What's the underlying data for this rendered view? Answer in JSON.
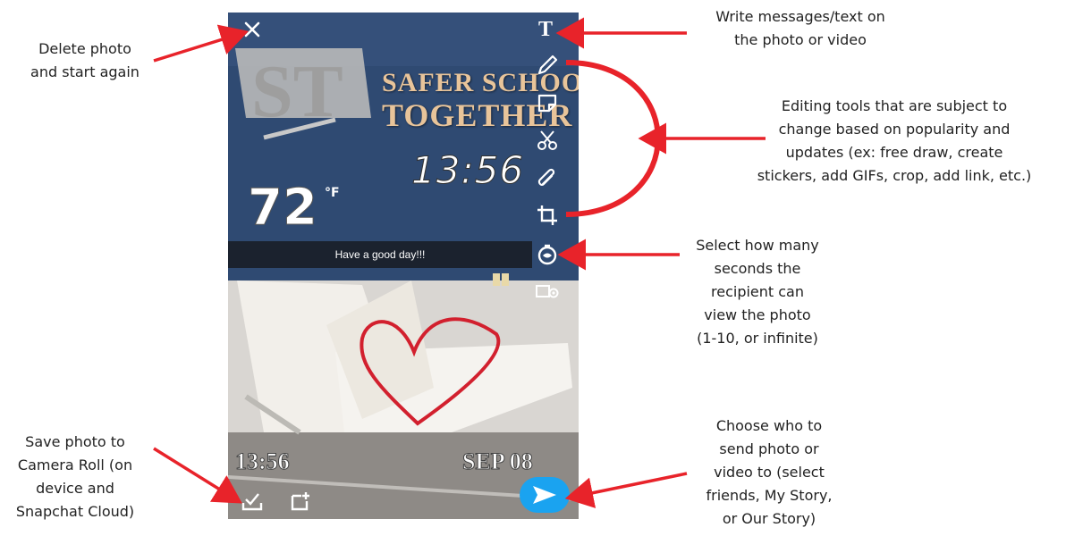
{
  "snap": {
    "brand_line1": "SAFER SCHOOLS",
    "brand_line2": "TOGETHER",
    "sticker_time": "13:56",
    "temperature": "72",
    "temperature_unit": "°F",
    "caption": "Have a good day!!!",
    "bottom_time": "13:56",
    "bottom_date": "SEP 08",
    "text_tool_glyph": "T"
  },
  "icons": {
    "close": "close-icon",
    "text": "text-tool-icon",
    "draw": "pencil-icon",
    "sticker": "sticker-icon",
    "scissors": "scissors-icon",
    "attach": "paperclip-icon",
    "crop": "crop-icon",
    "timer": "timer-icon",
    "viewers": "viewers-icon",
    "save": "save-download-icon",
    "add_story": "add-story-icon",
    "send": "send-arrow-icon"
  },
  "colors": {
    "wall": "#2f4a72",
    "send_button": "#1aa3f0",
    "annotation_arrow": "#e8232a",
    "brand_gold": "#e8c49a"
  },
  "annotations": {
    "delete": [
      "Delete photo",
      "and start again"
    ],
    "text": [
      "Write messages/text on",
      "the photo or video"
    ],
    "editing": [
      "Editing tools that are subject to",
      "change based on popularity and",
      "updates (ex: free draw, create",
      "stickers, add GIFs, crop, add link, etc.)"
    ],
    "timer": [
      "Select how many",
      "seconds the",
      "recipient can",
      "view the photo",
      "(1-10, or infinite)"
    ],
    "save": [
      "Save photo to",
      "Camera Roll (on",
      "device and",
      "Snapchat Cloud)"
    ],
    "send": [
      "Choose who to",
      "send photo or",
      "video to (select",
      "friends, My Story,",
      "or Our Story)"
    ]
  }
}
